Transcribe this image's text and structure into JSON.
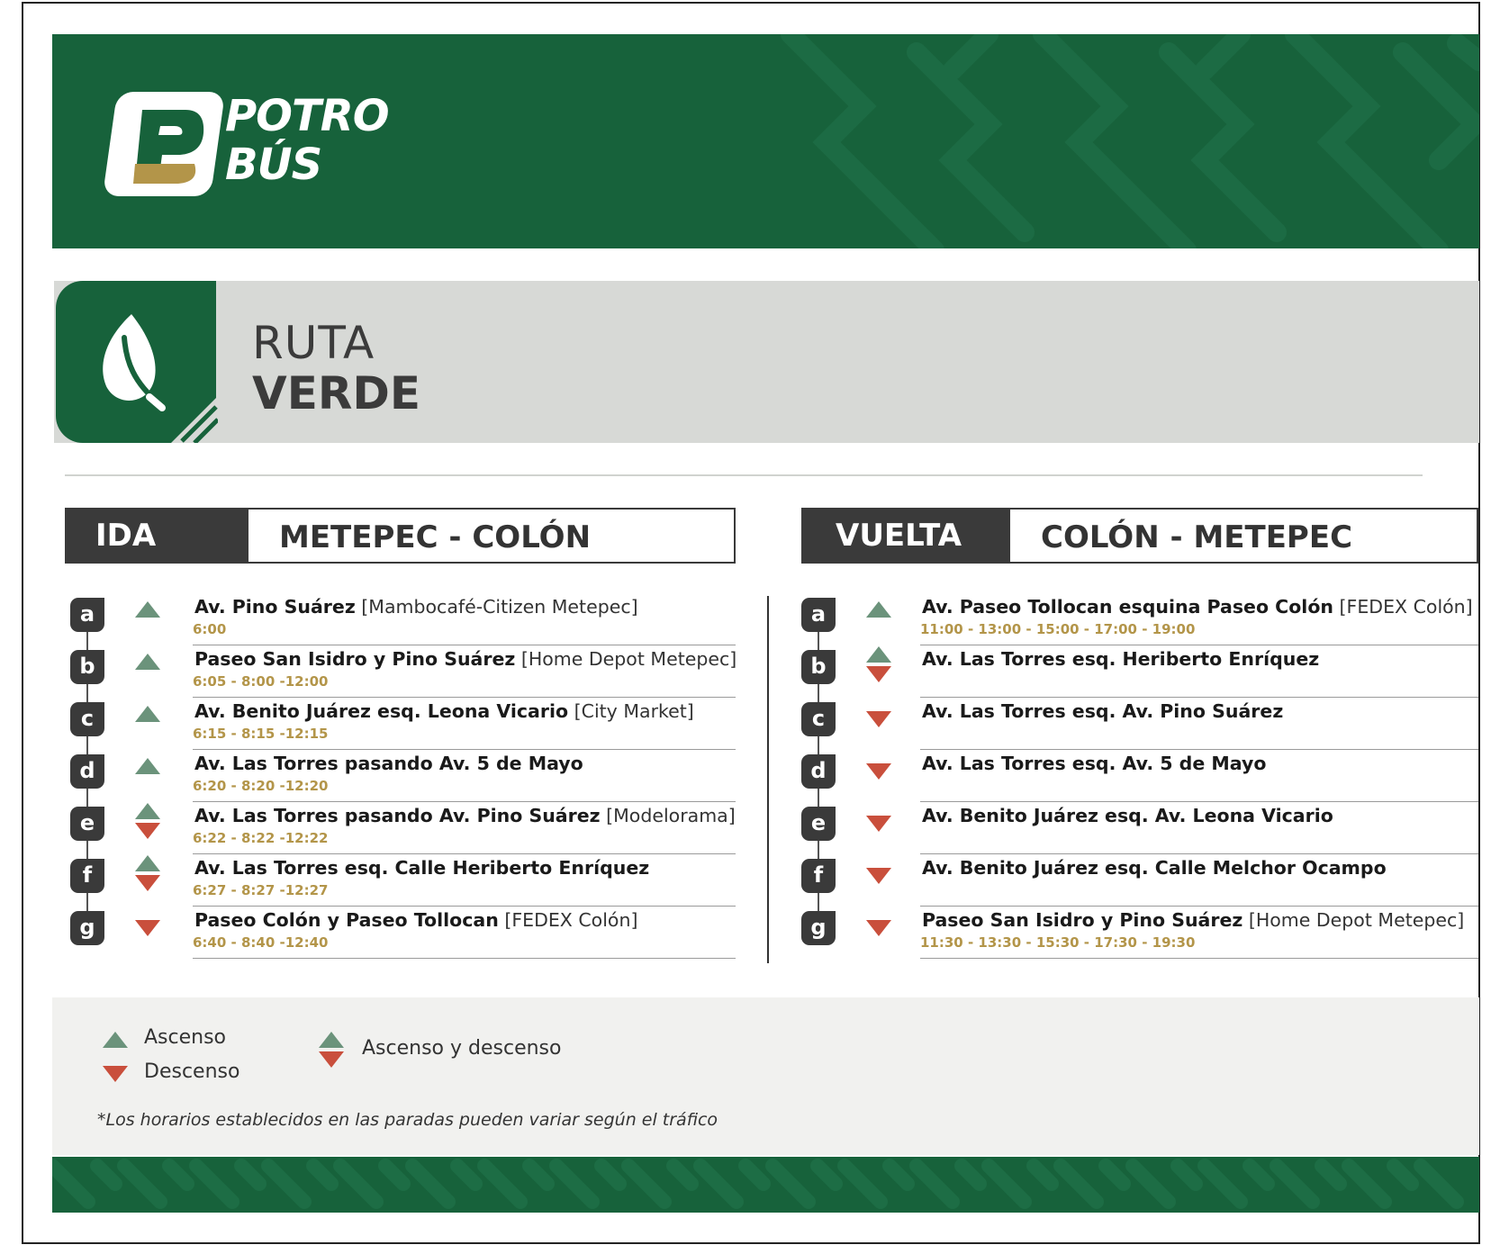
{
  "brand": {
    "logo_line1": "POTRO",
    "logo_line2": "BÚS",
    "logo_letter": "P"
  },
  "route": {
    "line1": "RUTA",
    "line2": "VERDE"
  },
  "ida": {
    "tag": "IDA",
    "route": "METEPEC - COLÓN",
    "stops": [
      {
        "id": "a",
        "type": "up",
        "name": "Av. Pino Suárez",
        "ref": " [Mambocafé-Citizen Metepec]",
        "times": "6:00"
      },
      {
        "id": "b",
        "type": "up",
        "name": "Paseo San Isidro y Pino Suárez",
        "ref": " [Home Depot Metepec]",
        "times": "6:05 - 8:00 -12:00"
      },
      {
        "id": "c",
        "type": "up",
        "name": "Av. Benito Juárez esq. Leona Vicario",
        "ref": " [City Market]",
        "times": "6:15 - 8:15 -12:15"
      },
      {
        "id": "d",
        "type": "up",
        "name": "Av. Las Torres pasando  Av. 5 de Mayo",
        "ref": "",
        "times": "6:20 - 8:20 -12:20"
      },
      {
        "id": "e",
        "type": "both",
        "name": "Av. Las Torres pasando Av. Pino Suárez",
        "ref": " [Modelorama]",
        "times": "6:22 - 8:22 -12:22"
      },
      {
        "id": "f",
        "type": "both",
        "name": "Av. Las Torres esq. Calle Heriberto Enríquez",
        "ref": "",
        "times": "6:27 - 8:27 -12:27"
      },
      {
        "id": "g",
        "type": "down",
        "name": "Paseo Colón y Paseo Tollocan",
        "ref": " [FEDEX Colón]",
        "times": "6:40 - 8:40 -12:40"
      }
    ]
  },
  "vuelta": {
    "tag": "VUELTA",
    "route": "COLÓN - METEPEC",
    "stops": [
      {
        "id": "a",
        "type": "up",
        "name": "Av. Paseo Tollocan esquina Paseo Colón",
        "ref": " [FEDEX Colón]",
        "times": "11:00 - 13:00 - 15:00 - 17:00 - 19:00"
      },
      {
        "id": "b",
        "type": "both",
        "name": "Av. Las Torres esq. Heriberto Enríquez",
        "ref": "",
        "times": ""
      },
      {
        "id": "c",
        "type": "down",
        "name": "Av. Las Torres esq. Av. Pino Suárez",
        "ref": "",
        "times": ""
      },
      {
        "id": "d",
        "type": "down",
        "name": "Av. Las Torres esq.  Av. 5 de Mayo",
        "ref": "",
        "times": ""
      },
      {
        "id": "e",
        "type": "down",
        "name": "Av. Benito Juárez esq. Av. Leona Vicario",
        "ref": "",
        "times": ""
      },
      {
        "id": "f",
        "type": "down",
        "name": "Av. Benito Juárez  esq. Calle Melchor Ocampo",
        "ref": "",
        "times": ""
      },
      {
        "id": "g",
        "type": "down",
        "name": "Paseo San Isidro y Pino Suárez",
        "ref": " [Home Depot Metepec]",
        "times": "11:30 - 13:30 - 15:30 - 17:30 - 19:30"
      }
    ]
  },
  "legend": {
    "ascenso": "Ascenso",
    "descenso": "Descenso",
    "ambos": "Ascenso y descenso",
    "note": "*Los horarios establecidos en las paradas pueden variar según el tráfico"
  },
  "colors": {
    "green": "#17623b",
    "up": "#6b937b",
    "down": "#c94f3c",
    "gold": "#b39549",
    "dark": "#3a3a3a"
  },
  "icons": {
    "leaf": "leaf-icon",
    "up": "triangle-up-icon",
    "down": "triangle-down-icon"
  }
}
